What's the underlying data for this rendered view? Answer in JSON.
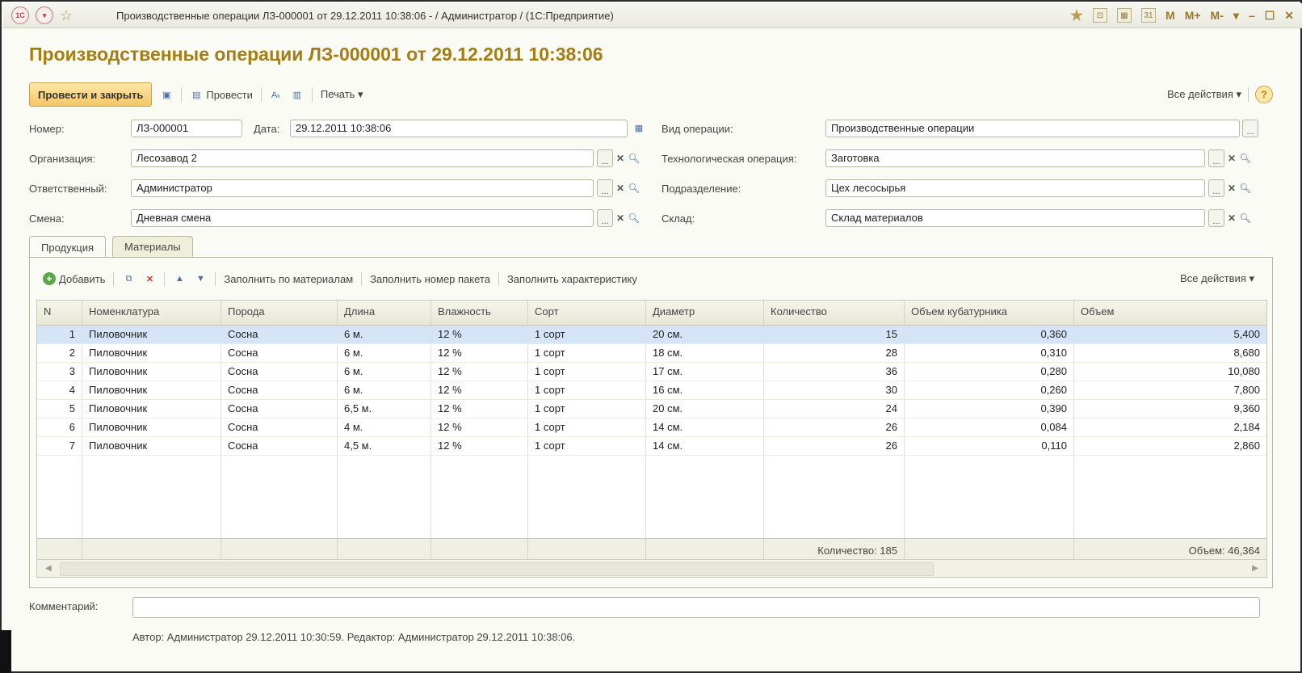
{
  "window": {
    "title": "Производственные операции ЛЗ-000001 от 29.12.2011 10:38:06 - / Администратор / (1С:Предприятие)",
    "logo": "1С",
    "right_controls": [
      "M",
      "M+",
      "M-"
    ]
  },
  "document": {
    "title": "Производственные операции ЛЗ-000001 от 29.12.2011 10:38:06"
  },
  "toolbar": {
    "post_close": "Провести и закрыть",
    "post": "Провести",
    "print": "Печать ▾",
    "all_actions": "Все действия ▾",
    "help": "?"
  },
  "form": {
    "number_label": "Номер:",
    "number_value": "ЛЗ-000001",
    "date_label": "Дата:",
    "date_value": "29.12.2011 10:38:06",
    "op_type_label": "Вид операции:",
    "op_type_value": "Производственные операции",
    "org_label": "Организация:",
    "org_value": "Лесозавод 2",
    "tech_label": "Технологическая операция:",
    "tech_value": "Заготовка",
    "resp_label": "Ответственный:",
    "resp_value": "Администратор",
    "dept_label": "Подразделение:",
    "dept_value": "Цех лесосырья",
    "shift_label": "Смена:",
    "shift_value": "Дневная смена",
    "warehouse_label": "Склад:",
    "warehouse_value": "Склад материалов"
  },
  "tabs": [
    {
      "label": "Продукция",
      "active": true
    },
    {
      "label": "Материалы",
      "active": false
    }
  ],
  "grid_toolbar": {
    "add": "Добавить",
    "fill_materials": "Заполнить по материалам",
    "fill_package": "Заполнить номер пакета",
    "fill_characteristic": "Заполнить характеристику",
    "all_actions": "Все действия ▾"
  },
  "table": {
    "columns": [
      "N",
      "Номенклатура",
      "Порода",
      "Длина",
      "Влажность",
      "Сорт",
      "Диаметр",
      "Количество",
      "Объем кубатурника",
      "Объем"
    ],
    "rows": [
      [
        "1",
        "Пиловочник",
        "Сосна",
        "6 м.",
        "12 %",
        "1 сорт",
        "20 см.",
        "15",
        "0,360",
        "5,400"
      ],
      [
        "2",
        "Пиловочник",
        "Сосна",
        "6 м.",
        "12 %",
        "1 сорт",
        "18 см.",
        "28",
        "0,310",
        "8,680"
      ],
      [
        "3",
        "Пиловочник",
        "Сосна",
        "6 м.",
        "12 %",
        "1 сорт",
        "17 см.",
        "36",
        "0,280",
        "10,080"
      ],
      [
        "4",
        "Пиловочник",
        "Сосна",
        "6 м.",
        "12 %",
        "1 сорт",
        "16 см.",
        "30",
        "0,260",
        "7,800"
      ],
      [
        "5",
        "Пиловочник",
        "Сосна",
        "6,5 м.",
        "12 %",
        "1 сорт",
        "20 см.",
        "24",
        "0,390",
        "9,360"
      ],
      [
        "6",
        "Пиловочник",
        "Сосна",
        "4 м.",
        "12 %",
        "1 сорт",
        "14 см.",
        "26",
        "0,084",
        "2,184"
      ],
      [
        "7",
        "Пиловочник",
        "Сосна",
        "4,5 м.",
        "12 %",
        "1 сорт",
        "14 см.",
        "26",
        "0,110",
        "2,860"
      ]
    ],
    "total_quantity": "Количество: 185",
    "total_volume": "Объем: 46,364"
  },
  "footer": {
    "comment_label": "Комментарий:",
    "author_line": "Автор: Администратор 29.12.2011 10:30:59. Редактор: Администратор 29.12.2011 10:38:06."
  }
}
